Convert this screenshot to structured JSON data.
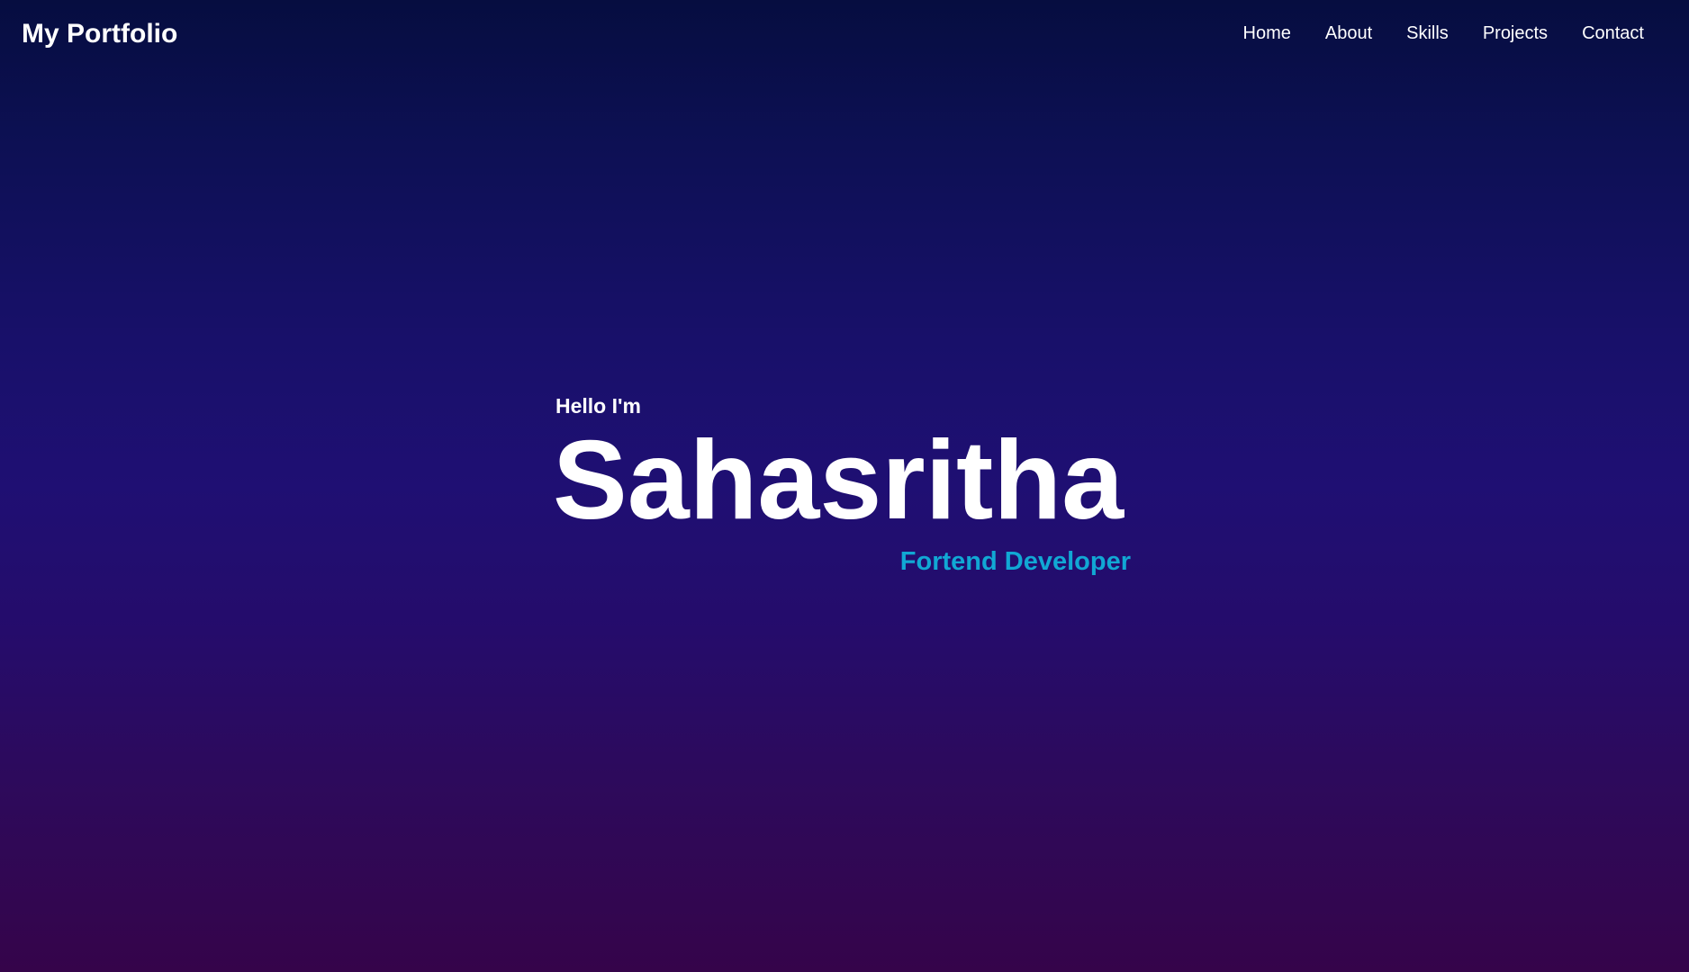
{
  "header": {
    "brand": "My Portfolio",
    "nav": [
      {
        "label": "Home"
      },
      {
        "label": "About"
      },
      {
        "label": "Skills"
      },
      {
        "label": "Projects"
      },
      {
        "label": "Contact"
      }
    ]
  },
  "hero": {
    "greeting": "Hello I'm",
    "name": "Sahasritha",
    "role": "Fortend Developer"
  },
  "colors": {
    "accent": "#11a8d4",
    "text": "#ffffff",
    "background_top": "#060d40",
    "background_bottom": "#35044a"
  }
}
